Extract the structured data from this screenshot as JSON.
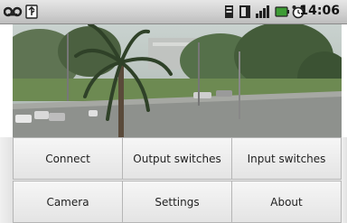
{
  "status_bar": {
    "time": "14:06",
    "icons": [
      "voicemail-icon",
      "usb-icon",
      "sd-card-icon",
      "vibrate-icon",
      "signal-icon",
      "battery-icon",
      "alarm-icon"
    ]
  },
  "menu": {
    "connect": "Connect",
    "output_switches": "Output switches",
    "input_switches": "Input switches",
    "camera": "Camera",
    "settings": "Settings",
    "about": "About"
  },
  "colors": {
    "status_bar_bg": "#cfcfcf",
    "menu_bg": "#ececec",
    "menu_text": "#222222"
  }
}
